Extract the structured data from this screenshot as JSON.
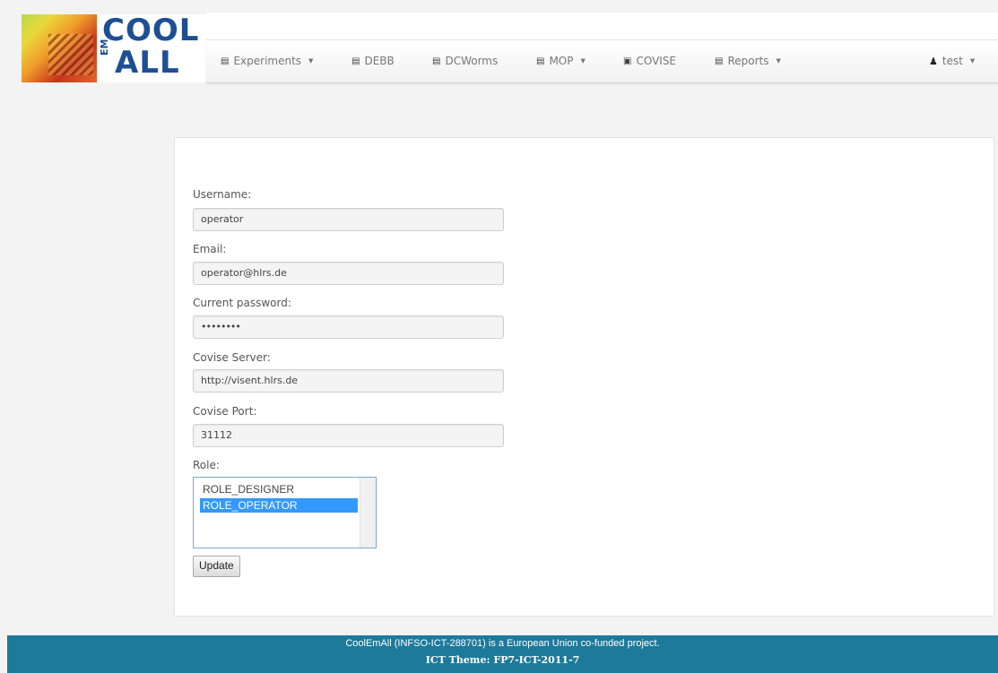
{
  "brand": {
    "logo_line1": "COOL",
    "logo_em": "EM",
    "logo_line2": "ALL",
    "accent_color": "#1d4f92"
  },
  "navbar": {
    "items": [
      {
        "label": "Experiments",
        "icon": "list-icon",
        "dropdown": true
      },
      {
        "label": "DEBB",
        "icon": "list-icon",
        "dropdown": false
      },
      {
        "label": "DCWorms",
        "icon": "list-icon",
        "dropdown": false
      },
      {
        "label": "MOP",
        "icon": "list-icon",
        "dropdown": true
      },
      {
        "label": "COVISE",
        "icon": "save-icon",
        "dropdown": false
      },
      {
        "label": "Reports",
        "icon": "list-icon",
        "dropdown": true
      }
    ],
    "user": {
      "label": "test",
      "icon": "user-icon"
    }
  },
  "form": {
    "username_label": "Username:",
    "username_value": "operator",
    "email_label": "Email:",
    "email_value": "operator@hlrs.de",
    "password_label": "Current password:",
    "password_value": "••••••••",
    "server_label": "Covise Server:",
    "server_value": "http://visent.hlrs.de",
    "port_label": "Covise Port:",
    "port_value": "31112",
    "role_label": "Role:",
    "role_options": [
      "ROLE_DESIGNER",
      "ROLE_OPERATOR"
    ],
    "role_selected": "ROLE_OPERATOR",
    "update_label": "Update"
  },
  "footer": {
    "line1": "CoolEmAll (INFSO-ICT-288701) is a European Union co-funded project.",
    "line2": "ICT Theme: FP7-ICT-2011-7",
    "color": "#1d7a9b"
  }
}
